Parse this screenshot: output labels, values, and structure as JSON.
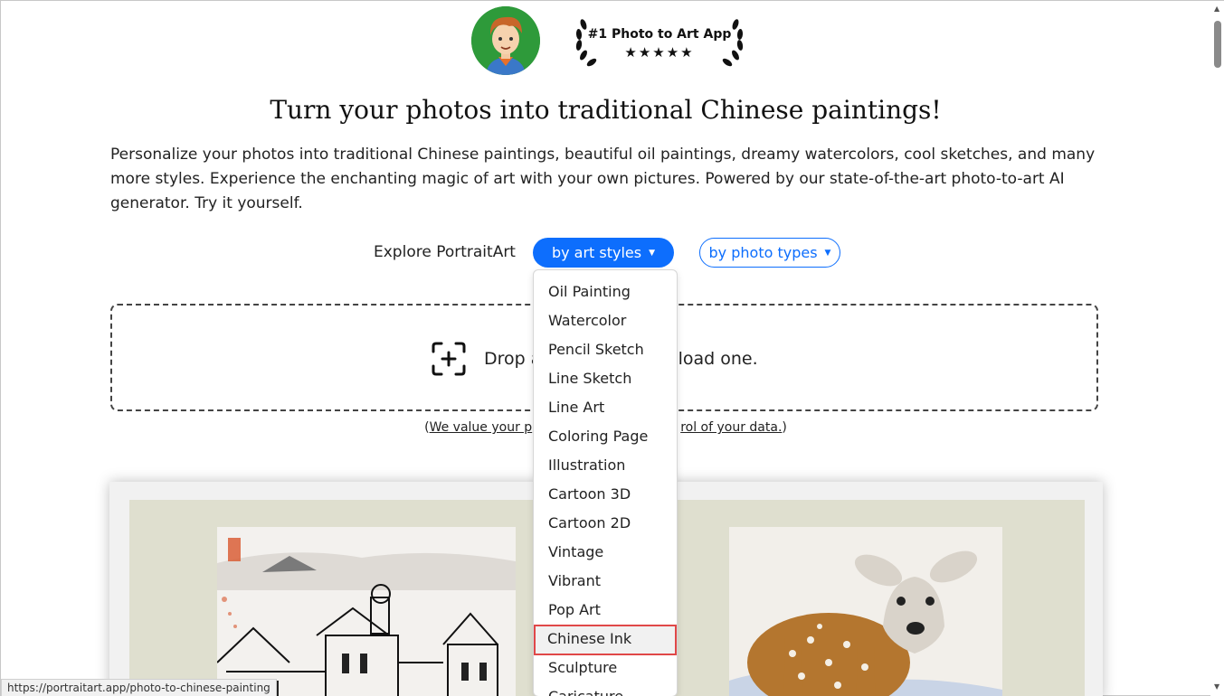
{
  "header": {
    "avatar_icon": "cartoon-boy-avatar",
    "badge_title": "#1 Photo to Art App",
    "badge_stars": "★★★★★",
    "badge_icon": "laurel-wreath-icon"
  },
  "hero": {
    "headline": "Turn your photos into traditional Chinese paintings!",
    "intro": "Personalize your photos into traditional Chinese paintings, beautiful oil paintings, dreamy watercolors, cool sketches, and many more styles. Experience the enchanting magic of art with your own pictures. Powered by our state-of-the-art photo-to-art AI generator. Try it yourself."
  },
  "explore": {
    "label": "Explore PortraitArt",
    "styles_button": "by art styles",
    "types_button": "by photo types"
  },
  "upload": {
    "icon": "add-photo-icon",
    "text_left": "Drop a",
    "text_right": "lick to load one."
  },
  "privacy": {
    "open": "(",
    "link_left": "We value your p",
    "link_right": "rol of your data.",
    "close": ")"
  },
  "dropdown": {
    "items": [
      "Oil Painting",
      "Watercolor",
      "Pencil Sketch",
      "Line Sketch",
      "Line Art",
      "Coloring Page",
      "Illustration",
      "Cartoon 3D",
      "Cartoon 2D",
      "Vintage",
      "Vibrant",
      "Pop Art",
      "Chinese Ink",
      "Sculpture",
      "Caricature"
    ],
    "highlighted": "Chinese Ink"
  },
  "status_bar": {
    "url": "https://portraitart.app/photo-to-chinese-painting"
  },
  "colors": {
    "primary": "#0d6efd",
    "highlight_border": "#e04848"
  }
}
